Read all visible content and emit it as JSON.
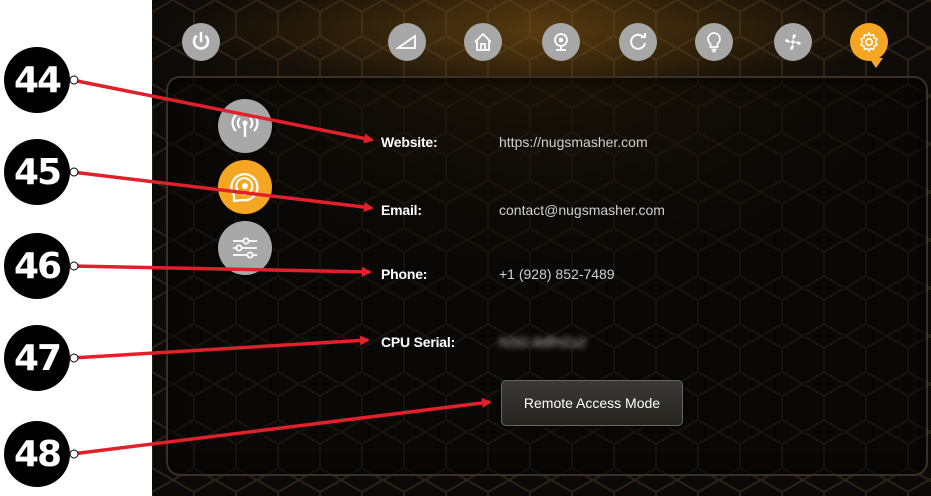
{
  "colors": {
    "accent": "#f5a623",
    "icon_inactive": "#a8a8a8",
    "callout_line": "#e0202a",
    "background": "#0c0a08"
  },
  "top_nav": [
    {
      "icon": "power-icon"
    },
    {
      "icon": "ramp-icon"
    },
    {
      "icon": "home-icon"
    },
    {
      "icon": "camera-icon"
    },
    {
      "icon": "refresh-icon"
    },
    {
      "icon": "lightbulb-icon"
    },
    {
      "icon": "fan-icon"
    },
    {
      "icon": "gear-icon",
      "active": true
    }
  ],
  "side_nav": [
    {
      "icon": "wireless-icon"
    },
    {
      "icon": "support-icon",
      "active": true
    },
    {
      "icon": "sliders-icon"
    }
  ],
  "info": {
    "website_label": "Website:",
    "website_value": "https://nugsmasher.com",
    "email_label": "Email:",
    "email_value": "contact@nugsmasher.com",
    "phone_label": "Phone:",
    "phone_value": "+1 (928) 852-7489",
    "cpu_label": "CPU Serial:",
    "cpu_value": "NSD-8dfHZs2"
  },
  "remote_button_label": "Remote Access Mode",
  "callouts": [
    "44",
    "45",
    "46",
    "47",
    "48"
  ]
}
